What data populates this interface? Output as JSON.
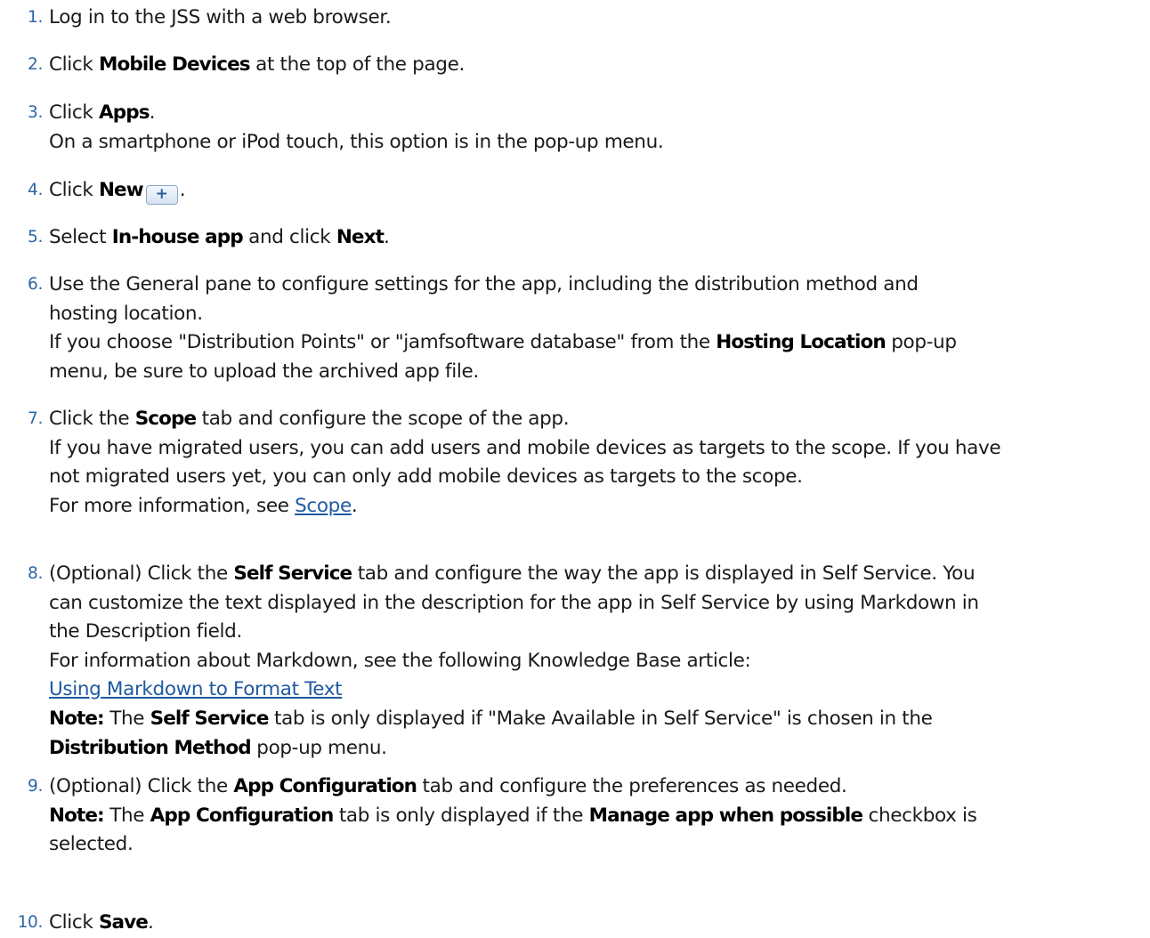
{
  "steps": [
    {
      "num": "1.",
      "lines": [
        [
          {
            "t": "text",
            "v": "Log in to the JSS with a web browser."
          }
        ]
      ]
    },
    {
      "num": "2.",
      "lines": [
        [
          {
            "t": "text",
            "v": "Click "
          },
          {
            "t": "bold",
            "v": "Mobile Devices"
          },
          {
            "t": "text",
            "v": " at the top of the page."
          }
        ]
      ]
    },
    {
      "num": "3.",
      "lines": [
        [
          {
            "t": "text",
            "v": "Click "
          },
          {
            "t": "bold",
            "v": "Apps"
          },
          {
            "t": "text",
            "v": "."
          }
        ],
        [
          {
            "t": "text",
            "v": "On a smartphone or iPod touch, this option is in the pop-up menu."
          }
        ]
      ]
    },
    {
      "num": "4.",
      "lines": [
        [
          {
            "t": "text",
            "v": "Click "
          },
          {
            "t": "bold",
            "v": "New"
          },
          {
            "t": "icon",
            "v": "+",
            "name": "new-plus-icon"
          },
          {
            "t": "text",
            "v": "."
          }
        ]
      ]
    },
    {
      "num": "5.",
      "lines": [
        [
          {
            "t": "text",
            "v": "Select "
          },
          {
            "t": "bold",
            "v": "In-house app"
          },
          {
            "t": "text",
            "v": " and click "
          },
          {
            "t": "bold",
            "v": "Next"
          },
          {
            "t": "text",
            "v": "."
          }
        ]
      ]
    },
    {
      "num": "6.",
      "lines": [
        [
          {
            "t": "text",
            "v": "Use the General pane to configure settings for the app, including the distribution method and"
          }
        ],
        [
          {
            "t": "text",
            "v": "hosting location."
          }
        ],
        [
          {
            "t": "text",
            "v": "If you choose \"Distribution Points\" or \"jamfsoftware database\" from the "
          },
          {
            "t": "bold",
            "v": "Hosting Location"
          },
          {
            "t": "text",
            "v": " pop-up"
          }
        ],
        [
          {
            "t": "text",
            "v": "menu, be sure to upload the archived app file."
          }
        ]
      ]
    },
    {
      "num": "7.",
      "lines": [
        [
          {
            "t": "text",
            "v": "Click the "
          },
          {
            "t": "bold",
            "v": "Scope"
          },
          {
            "t": "text",
            "v": " tab and configure the scope of the app."
          }
        ],
        [
          {
            "t": "text",
            "v": "If you have migrated users, you can add users and mobile devices as targets to the scope. If you have"
          }
        ],
        [
          {
            "t": "text",
            "v": "not migrated users yet, you can only add mobile devices as targets to the scope."
          }
        ],
        [
          {
            "t": "text",
            "v": "For more information, see "
          },
          {
            "t": "link",
            "v": "Scope",
            "name": "scope-link"
          },
          {
            "t": "text",
            "v": "."
          }
        ]
      ]
    },
    {
      "num": "8.",
      "lines": [
        [
          {
            "t": "text",
            "v": "(Optional) Click the "
          },
          {
            "t": "bold",
            "v": "Self Service"
          },
          {
            "t": "text",
            "v": " tab and configure the way the app is displayed in Self Service. You"
          }
        ],
        [
          {
            "t": "text",
            "v": "can customize the text displayed in the description for the app in Self Service by using Markdown in"
          }
        ],
        [
          {
            "t": "text",
            "v": "the Description field."
          }
        ],
        [
          {
            "t": "text",
            "v": "For information about Markdown, see the following Knowledge Base article:"
          }
        ],
        [
          {
            "t": "link",
            "v": "Using Markdown to Format Text",
            "name": "markdown-article-link"
          }
        ],
        [
          {
            "t": "bold",
            "v": "Note:"
          },
          {
            "t": "text",
            "v": " The "
          },
          {
            "t": "bold",
            "v": "Self Service"
          },
          {
            "t": "text",
            "v": " tab is only displayed if \"Make Available in Self Service\" is chosen in the"
          }
        ],
        [
          {
            "t": "bold",
            "v": "Distribution Method"
          },
          {
            "t": "text",
            "v": " pop-up menu."
          }
        ]
      ]
    },
    {
      "num": "9.",
      "lines": [
        [
          {
            "t": "text",
            "v": "(Optional) Click the "
          },
          {
            "t": "bold",
            "v": "App Configuration"
          },
          {
            "t": "text",
            "v": " tab and configure the preferences as needed."
          }
        ],
        [
          {
            "t": "bold",
            "v": "Note:"
          },
          {
            "t": "text",
            "v": " The "
          },
          {
            "t": "bold",
            "v": "App Configuration"
          },
          {
            "t": "text",
            "v": " tab is only displayed if the "
          },
          {
            "t": "bold",
            "v": "Manage app when possible"
          },
          {
            "t": "text",
            "v": " checkbox is"
          }
        ],
        [
          {
            "t": "text",
            "v": "selected."
          }
        ]
      ]
    },
    {
      "num": "10.",
      "lines": [
        [
          {
            "t": "text",
            "v": "Click "
          },
          {
            "t": "bold",
            "v": "Save"
          },
          {
            "t": "text",
            "v": "."
          }
        ]
      ]
    }
  ]
}
